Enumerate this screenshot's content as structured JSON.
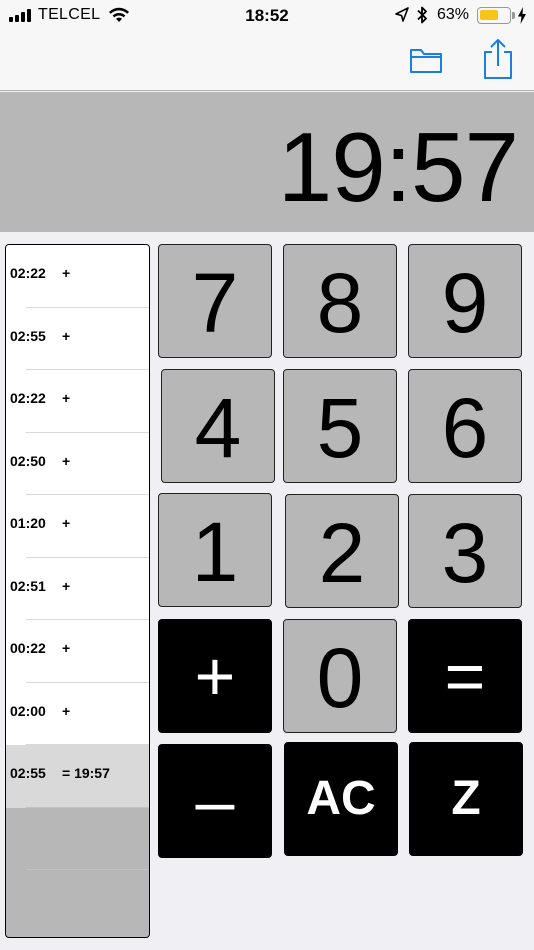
{
  "status_bar": {
    "carrier": "TELCEL",
    "time": "18:52",
    "battery_percent_label": "63%",
    "battery_level": 0.63,
    "battery_color": "#f5c518",
    "icons": [
      "signal-icon",
      "wifi-icon",
      "location-arrow-icon",
      "bluetooth-icon",
      "battery-icon",
      "charging-bolt-icon"
    ]
  },
  "nav_bar": {
    "icons": [
      "folder-icon",
      "share-icon"
    ],
    "accent_color": "#1a7fe0"
  },
  "display": {
    "value": "19:57"
  },
  "tape": {
    "rows": [
      {
        "time": "02:22",
        "op": "+"
      },
      {
        "time": "02:55",
        "op": "+"
      },
      {
        "time": "02:22",
        "op": "+"
      },
      {
        "time": "02:50",
        "op": "+"
      },
      {
        "time": "01:20",
        "op": "+"
      },
      {
        "time": "02:51",
        "op": "+"
      },
      {
        "time": "00:22",
        "op": "+"
      },
      {
        "time": "02:00",
        "op": "+"
      },
      {
        "time": "02:55",
        "op": "= 19:57"
      }
    ]
  },
  "keypad": {
    "seven": "7",
    "eight": "8",
    "nine": "9",
    "four": "4",
    "five": "5",
    "six": "6",
    "one": "1",
    "two": "2",
    "three": "3",
    "plus": "+",
    "zero": "0",
    "equals": "=",
    "minus": "–",
    "clear": "AC",
    "z": "Z"
  }
}
